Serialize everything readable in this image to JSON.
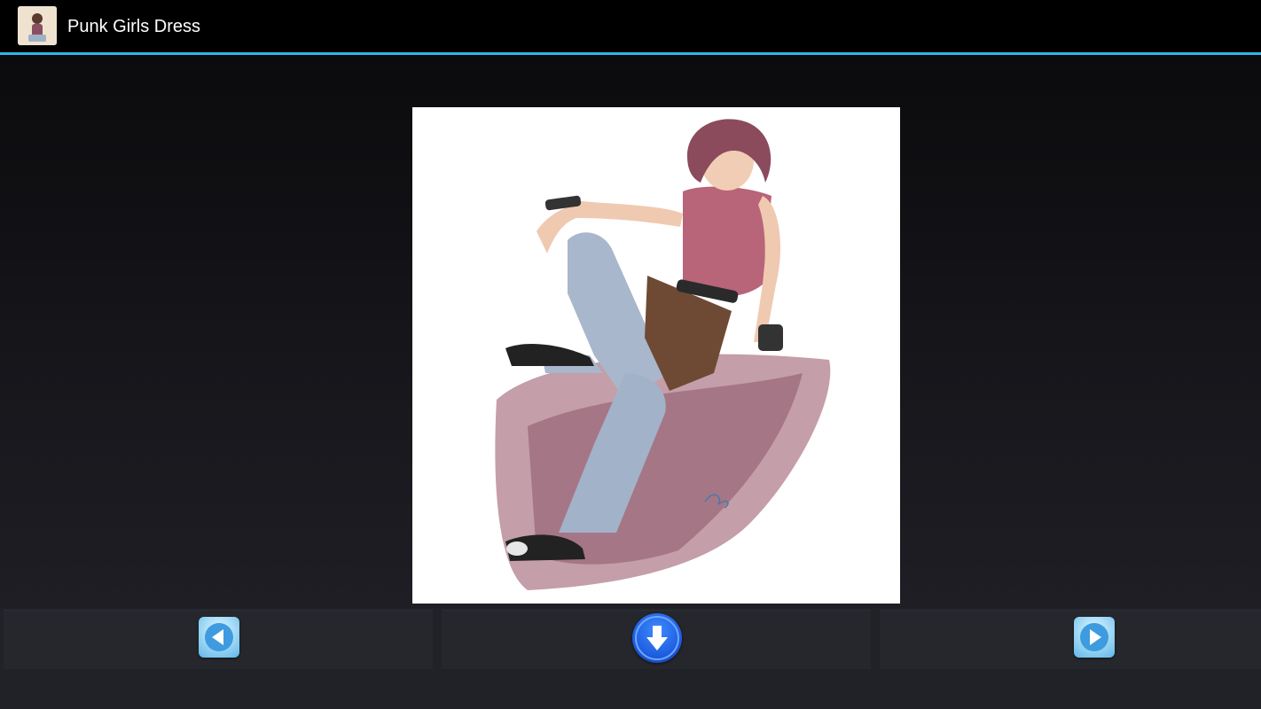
{
  "app": {
    "title": "Punk Girls Dress"
  },
  "colors": {
    "accent_divider": "#33b5e5",
    "action_bar": "#000000",
    "bottom_bar": "#202228",
    "nav_button_light": "#a7dcf6",
    "download_button": "#1f5fe0"
  },
  "icons": {
    "app": "app-thumbnail-icon",
    "previous": "arrow-left-icon",
    "download": "arrow-down-icon",
    "next": "arrow-right-icon"
  }
}
